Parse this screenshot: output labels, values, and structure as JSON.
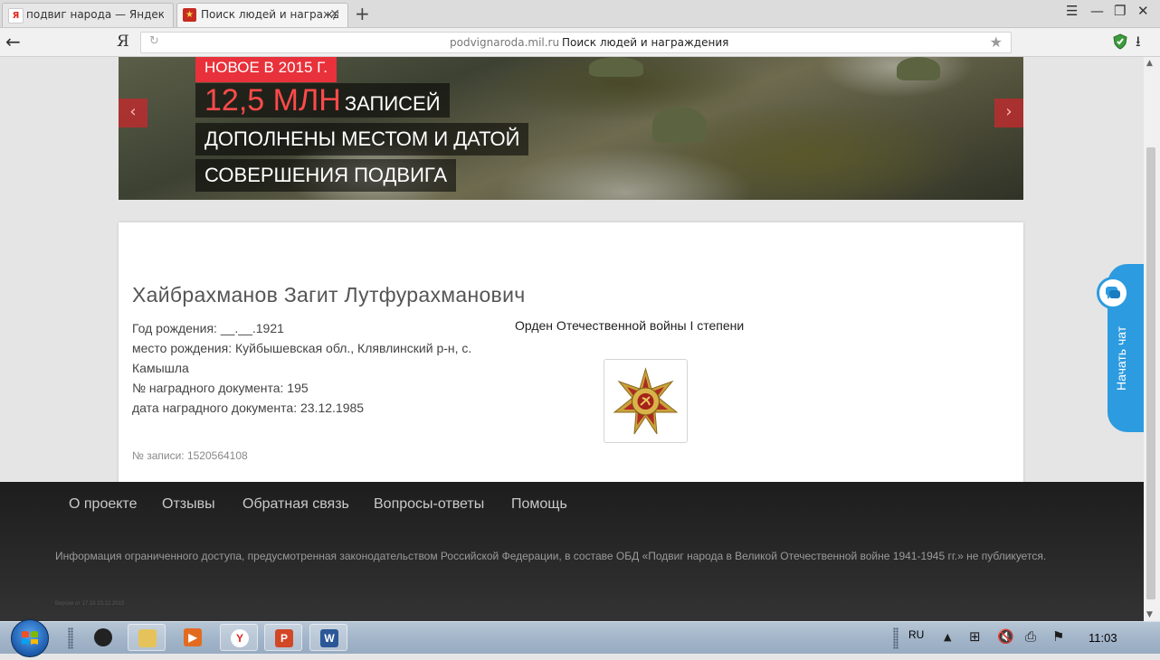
{
  "browser": {
    "tabs": [
      {
        "title": "подвиг народа — Яндекс: на",
        "favicon": "Я",
        "active": false
      },
      {
        "title": "Поиск людей и награжде",
        "favicon": "★",
        "active": true
      }
    ],
    "new_tab": "+",
    "address": {
      "host": "podvignaroda.mil.ru",
      "title": "Поиск людей и награждения",
      "logo": "Я"
    }
  },
  "banner": {
    "badge": "НОВОЕ В 2015 Г.",
    "big_number": "12,5 МЛН",
    "line1_rest": "ЗАПИСЕЙ",
    "line2": "ДОПОЛНЕНЫ МЕСТОМ И ДАТОЙ",
    "line3": "СОВЕРШЕНИЯ ПОДВИГА",
    "prev_icon": "‹",
    "next_icon": "›"
  },
  "person": {
    "name": "Хайбрахманов Загит Лутфурахманович",
    "birth_year": "Год рождения: __.__.1921",
    "birth_place": "место рождения: Куйбышевская обл., Клявлинский р-н, с. Камышла",
    "award_doc_no": "№ наградного документа: 195",
    "award_doc_date": "дата наградного документа: 23.12.1985",
    "record_no": "№ записи: 1520564108"
  },
  "award": {
    "name": "Орден Отечественной войны I степени"
  },
  "chat": {
    "label": "Начать чат"
  },
  "footer": {
    "links": [
      "О проекте",
      "Отзывы",
      "Обратная связь",
      "Вопросы-ответы",
      "Помощь"
    ],
    "info": "Информация ограниченного доступа, предусмотренная законодательством Российской Федерации, в составе ОБД «Подвиг народа в Великой Отечественной войне 1941-1945 гг.» не публикуется.",
    "version": "Версия от 17.33 23.12.2015"
  },
  "taskbar": {
    "language": "RU",
    "clock": "11:03"
  },
  "colors": {
    "accent_red": "#e8313a",
    "chat_blue": "#2d9be0",
    "footer_bg": "#222222"
  }
}
